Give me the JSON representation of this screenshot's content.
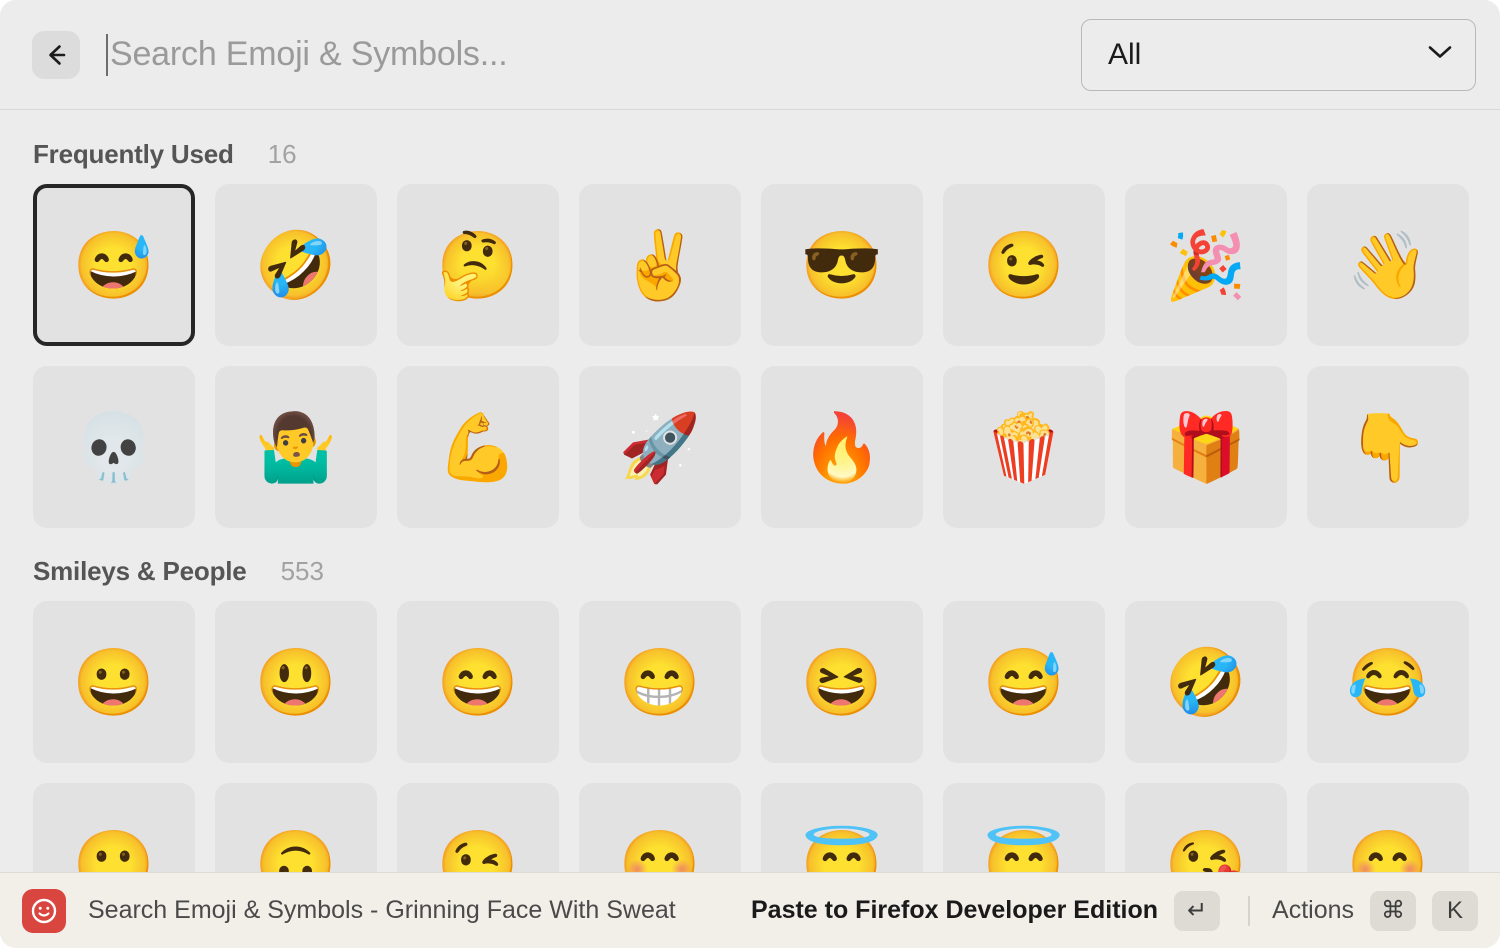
{
  "window": {
    "background": "#ececec",
    "status_bar_background": "#f2efe9"
  },
  "toolbar": {
    "back_button_icon": "arrow-left-icon",
    "search": {
      "value": "",
      "placeholder": "Search Emoji & Symbols..."
    },
    "category_select": {
      "value": "All",
      "chevron_icon": "chevron-down-icon"
    }
  },
  "sections": [
    {
      "title": "Frequently Used",
      "count": "16",
      "emojis": [
        {
          "glyph": "😅",
          "name": "Grinning Face With Sweat",
          "selected": true
        },
        {
          "glyph": "🤣",
          "name": "Rolling on the Floor Laughing",
          "selected": false
        },
        {
          "glyph": "🤔",
          "name": "Thinking Face",
          "selected": false
        },
        {
          "glyph": "✌️",
          "name": "Victory Hand",
          "selected": false
        },
        {
          "glyph": "😎",
          "name": "Smiling Face With Sunglasses",
          "selected": false
        },
        {
          "glyph": "😉",
          "name": "Winking Face",
          "selected": false
        },
        {
          "glyph": "🎉",
          "name": "Party Popper",
          "selected": false
        },
        {
          "glyph": "👋",
          "name": "Waving Hand",
          "selected": false
        },
        {
          "glyph": "💀",
          "name": "Skull",
          "selected": false
        },
        {
          "glyph": "🤷‍♂️",
          "name": "Man Shrugging",
          "selected": false
        },
        {
          "glyph": "💪",
          "name": "Flexed Biceps",
          "selected": false
        },
        {
          "glyph": "🚀",
          "name": "Rocket",
          "selected": false
        },
        {
          "glyph": "🔥",
          "name": "Fire",
          "selected": false
        },
        {
          "glyph": "🍿",
          "name": "Popcorn",
          "selected": false
        },
        {
          "glyph": "🎁",
          "name": "Wrapped Gift",
          "selected": false
        },
        {
          "glyph": "👇",
          "name": "Backhand Index Pointing Down",
          "selected": false
        }
      ]
    },
    {
      "title": "Smileys & People",
      "count": "553",
      "emojis": [
        {
          "glyph": "😀",
          "name": "Grinning Face",
          "selected": false
        },
        {
          "glyph": "😃",
          "name": "Grinning Face With Big Eyes",
          "selected": false
        },
        {
          "glyph": "😄",
          "name": "Grinning Face With Smiling Eyes",
          "selected": false
        },
        {
          "glyph": "😁",
          "name": "Beaming Face With Smiling Eyes",
          "selected": false
        },
        {
          "glyph": "😆",
          "name": "Grinning Squinting Face",
          "selected": false
        },
        {
          "glyph": "😅",
          "name": "Grinning Face With Sweat",
          "selected": false
        },
        {
          "glyph": "🤣",
          "name": "Rolling on the Floor Laughing",
          "selected": false
        },
        {
          "glyph": "😂",
          "name": "Face With Tears of Joy",
          "selected": false
        },
        {
          "glyph": "🙂",
          "name": "Slightly Smiling Face",
          "selected": false
        },
        {
          "glyph": "🙃",
          "name": "Upside-Down Face",
          "selected": false
        },
        {
          "glyph": "😉",
          "name": "Winking Face",
          "selected": false
        },
        {
          "glyph": "😊",
          "name": "Smiling Face With Smiling Eyes",
          "selected": false
        },
        {
          "glyph": "😇",
          "name": "Smiling Face With Halo",
          "selected": false
        },
        {
          "glyph": "😇",
          "name": "Smiling Face With Halo",
          "selected": false
        },
        {
          "glyph": "😘",
          "name": "Face Blowing a Kiss",
          "selected": false
        },
        {
          "glyph": "😊",
          "name": "Smiling Face With Smiling Eyes",
          "selected": false
        }
      ]
    }
  ],
  "status_bar": {
    "app_icon": "emoji-smiley-app-icon",
    "title": "Search Emoji & Symbols - Grinning Face With Sweat",
    "primary_action_label": "Paste to Firefox Developer Edition",
    "primary_action_key": "↵",
    "actions_label": "Actions",
    "actions_keys": [
      "⌘",
      "K"
    ]
  }
}
